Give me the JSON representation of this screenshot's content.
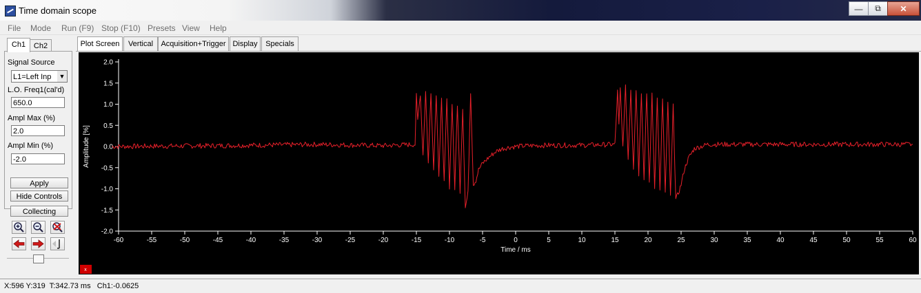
{
  "window": {
    "title": "Time domain scope",
    "minimize": "—",
    "maximize": "⧉",
    "close": "✕"
  },
  "menu": [
    "File",
    "Mode",
    "Run (F9)",
    "Stop (F10)",
    "Presets",
    "View",
    "Help"
  ],
  "channel_tabs": [
    "Ch1",
    "Ch2"
  ],
  "controls": {
    "signal_source_label": "Signal Source",
    "signal_source_value": "L1=Left Inp",
    "lo_freq_label": "L.O. Freq1(cal'd)",
    "lo_freq_value": "650.0",
    "ampl_max_label": "Ampl Max (%)",
    "ampl_max_value": "2.0",
    "ampl_min_label": "Ampl Min (%)",
    "ampl_min_value": "-2.0"
  },
  "buttons": {
    "apply": "Apply",
    "hide_controls": "Hide Controls",
    "collecting": "Collecting"
  },
  "plot_tabs": [
    "Plot Screen",
    "Vertical",
    "Acquisition+Trigger",
    "Display",
    "Specials"
  ],
  "status": "X:596 Y:319  T:342.73 ms   Ch1:-0.0625",
  "colors": {
    "trace": "#e8202a",
    "plot_bg": "#000000",
    "axis": "#ffffff"
  },
  "chart_data": {
    "type": "line",
    "xlabel": "Time / ms",
    "ylabel": "Amplitude [%]",
    "xlim": [
      -60,
      60
    ],
    "ylim": [
      -2.0,
      2.0
    ],
    "x_ticks": [
      "-60",
      "-55",
      "-50",
      "-45",
      "-40",
      "-35",
      "-30",
      "-25",
      "-20",
      "-15",
      "-10",
      "-5",
      "0",
      "5",
      "10",
      "15",
      "20",
      "25",
      "30",
      "35",
      "40",
      "45",
      "50",
      "55",
      "60"
    ],
    "y_ticks": [
      "2.0",
      "1.5",
      "1.0",
      "0.5",
      "0.0",
      "-0.5",
      "-1.0",
      "-1.5",
      "-2.0"
    ],
    "series": [
      {
        "x": [
          -61,
          -45,
          -30,
          -20,
          -15.2,
          -15,
          -14.8,
          -14.4,
          -14,
          -13.6,
          -13.2,
          -12.8,
          -12.4,
          -12,
          -11.6,
          -11.2,
          -10.8,
          -10.4,
          -10,
          -9.6,
          -9.2,
          -8.8,
          -8.4,
          -8,
          -7.6,
          -7.2,
          -6.8,
          -6.4,
          -6,
          -5.6,
          -5,
          -4,
          -3,
          -2,
          -1,
          0,
          2,
          5,
          10,
          15,
          15.4,
          15.6,
          15.8,
          16.2,
          16.6,
          17,
          17.4,
          17.8,
          18.2,
          18.6,
          19,
          19.4,
          19.8,
          20.2,
          20.6,
          21,
          21.4,
          21.8,
          22.2,
          22.6,
          23,
          23.4,
          23.8,
          24.2,
          24.6,
          25,
          25.4,
          25.8,
          26.2,
          26.6,
          27,
          28,
          29,
          30,
          31,
          33,
          40,
          50,
          60
        ],
        "y": [
          0.0,
          0.02,
          0.05,
          0.02,
          0.05,
          1.2,
          0.6,
          1.25,
          -0.2,
          1.3,
          -0.4,
          1.3,
          -0.55,
          1.25,
          -0.7,
          1.1,
          -0.85,
          1.1,
          -0.95,
          1.05,
          -1.0,
          1.0,
          -1.05,
          0.9,
          -1.45,
          -1.1,
          1.3,
          -0.9,
          -0.8,
          -0.55,
          -0.4,
          -0.25,
          -0.12,
          -0.05,
          -0.02,
          0.0,
          0.02,
          0.03,
          0.03,
          0.05,
          1.3,
          0.5,
          1.35,
          0.0,
          1.4,
          -0.3,
          1.35,
          -0.5,
          1.35,
          -0.65,
          1.3,
          -0.8,
          1.3,
          -0.9,
          1.25,
          -1.0,
          1.2,
          -1.05,
          1.1,
          -1.1,
          1.0,
          -1.2,
          0.95,
          -1.25,
          -1.1,
          -0.9,
          -0.6,
          -0.4,
          -0.25,
          -0.15,
          -0.05,
          0.0,
          0.05,
          0.05,
          0.05,
          0.05,
          0.05,
          0.05,
          0.05
        ]
      }
    ],
    "noise_amplitude": 0.06,
    "grid": false,
    "marker_value": "x"
  }
}
